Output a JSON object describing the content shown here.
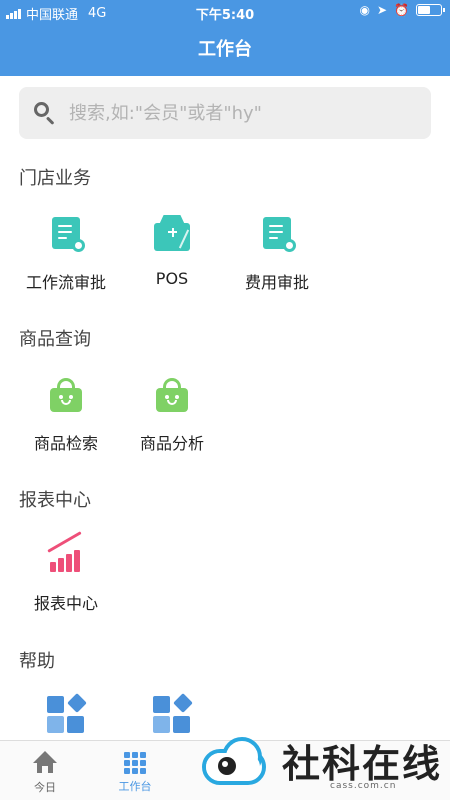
{
  "status_bar": {
    "carrier": "中国联通",
    "network": "4G",
    "time": "下午5:40",
    "battery_level": 0.6
  },
  "nav": {
    "title": "工作台"
  },
  "search": {
    "placeholder": "搜索,如:\"会员\"或者\"hy\"",
    "value": ""
  },
  "sections": [
    {
      "title": "门店业务",
      "items": [
        {
          "label": "工作流审批",
          "icon": "workflow-document-icon"
        },
        {
          "label": "POS",
          "icon": "pos-terminal-icon"
        },
        {
          "label": "费用审批",
          "icon": "expense-document-icon"
        }
      ]
    },
    {
      "title": "商品查询",
      "items": [
        {
          "label": "商品检索",
          "icon": "shopping-bag-icon"
        },
        {
          "label": "商品分析",
          "icon": "shopping-bag-icon"
        }
      ]
    },
    {
      "title": "报表中心",
      "items": [
        {
          "label": "报表中心",
          "icon": "bar-chart-trend-icon"
        }
      ]
    },
    {
      "title": "帮助",
      "items": [
        {
          "label": "",
          "icon": "app-grid-icon"
        },
        {
          "label": "",
          "icon": "app-grid-icon"
        }
      ]
    }
  ],
  "tabs": [
    {
      "label": "今日",
      "icon": "home-icon",
      "active": false
    },
    {
      "label": "工作台",
      "icon": "apps-grid-icon",
      "active": true
    }
  ],
  "watermark": {
    "title": "社科在线",
    "subtitle": "cass.com.cn"
  },
  "colors": {
    "primary": "#4a97e3",
    "teal": "#3cc6b9",
    "green": "#7fd165",
    "pink": "#ee4f79",
    "blue": "#4a90d9"
  }
}
